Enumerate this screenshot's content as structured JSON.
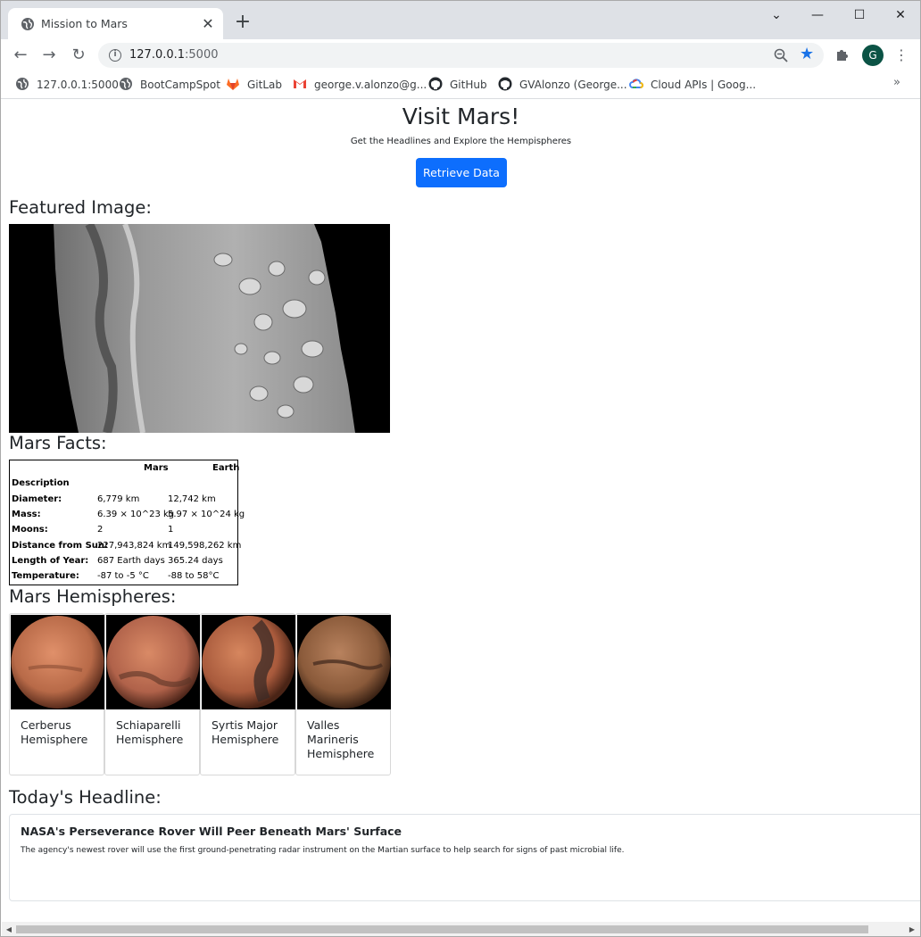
{
  "browser": {
    "tab_title": "Mission to Mars",
    "url_host": "127.0.0.1",
    "url_port": ":5000",
    "profile_initial": "G",
    "window_controls": {
      "minimize": "—",
      "maximize": "☐",
      "close": "✕",
      "tab_search": "⌄"
    },
    "bookmarks": [
      {
        "label": "127.0.0.1:5000",
        "icon": "globe-icon"
      },
      {
        "label": "BootCampSpot",
        "icon": "globe-icon"
      },
      {
        "label": "GitLab",
        "icon": "gitlab-icon"
      },
      {
        "label": "george.v.alonzo@g...",
        "icon": "gmail-icon"
      },
      {
        "label": "GitHub",
        "icon": "github-icon"
      },
      {
        "label": "GVAlonzo (George...",
        "icon": "github-icon"
      },
      {
        "label": "Cloud APIs  |  Goog...",
        "icon": "google-cloud-icon"
      }
    ],
    "bookmarks_overflow": "»"
  },
  "page": {
    "title": "Visit Mars!",
    "subtitle": "Get the Headlines and Explore the Hempispheres",
    "retrieve_button": "Retrieve Data",
    "featured_heading": "Featured Image:",
    "facts_heading": "Mars Facts:",
    "facts": {
      "columns": [
        "Mars",
        "Earth"
      ],
      "index_label": "Description",
      "rows": [
        {
          "label": "Diameter:",
          "mars": "6,779 km",
          "earth": "12,742 km"
        },
        {
          "label": "Mass:",
          "mars": "6.39 × 10^23 kg",
          "earth": "5.97 × 10^24 kg"
        },
        {
          "label": "Moons:",
          "mars": "2",
          "earth": "1"
        },
        {
          "label": "Distance from Sun:",
          "mars": "227,943,824 km",
          "earth": "149,598,262 km"
        },
        {
          "label": "Length of Year:",
          "mars": "687 Earth days",
          "earth": "365.24 days"
        },
        {
          "label": "Temperature:",
          "mars": "-87 to -5 °C",
          "earth": "-88 to 58°C"
        }
      ]
    },
    "hemispheres_heading": "Mars Hemispheres:",
    "hemispheres": [
      {
        "title": "Cerberus Hemisphere"
      },
      {
        "title": "Schiaparelli Hemisphere"
      },
      {
        "title": "Syrtis Major Hemisphere"
      },
      {
        "title": "Valles Marineris Hemisphere"
      }
    ],
    "headline_heading": "Today's Headline:",
    "headline": {
      "title": "NASA's Perseverance Rover Will Peer Beneath Mars' Surface",
      "teaser": "The agency's newest rover will use the first ground-penetrating radar instrument on the Martian surface to help search for signs of past microbial life."
    }
  }
}
